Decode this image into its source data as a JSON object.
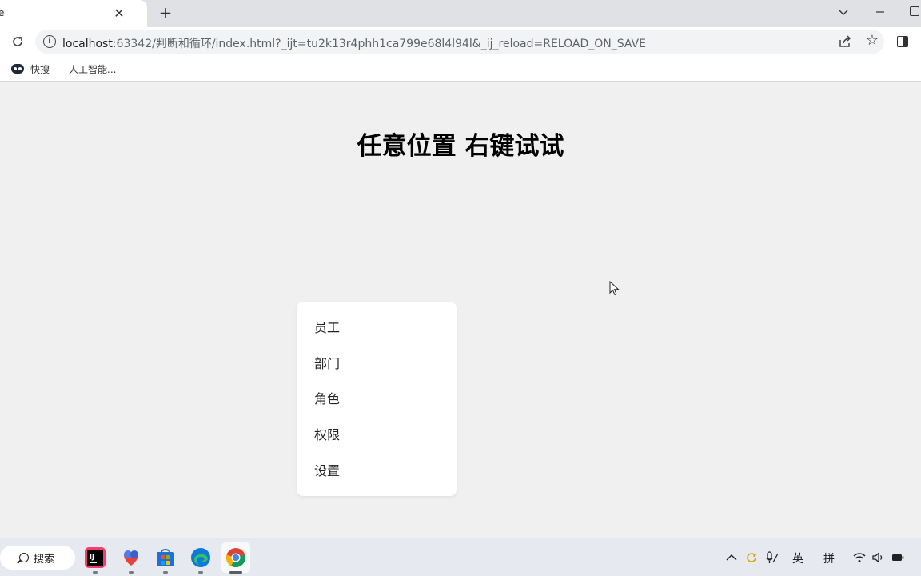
{
  "browser": {
    "tab_title": "e",
    "tab_close": "✕",
    "new_tab": "+",
    "url_host": "localhost",
    "url_rest": ":63342/判断和循环/index.html?_ijt=tu2k13r4phh1ca799e68l4l94l&_ij_reload=RELOAD_ON_SAVE",
    "info_glyph": "i",
    "star_glyph": "☆"
  },
  "bookmarks": {
    "items": [
      {
        "label": "快搜——人工智能..."
      }
    ]
  },
  "page": {
    "heading": "任意位置 右键试试"
  },
  "context_menu": {
    "items": [
      {
        "label": "员工"
      },
      {
        "label": "部门"
      },
      {
        "label": "角色"
      },
      {
        "label": "权限"
      },
      {
        "label": "设置"
      }
    ]
  },
  "taskbar": {
    "search_label": "搜索",
    "ime_lang": "英",
    "ime_mode": "拼",
    "apps": [
      "intellij-idea",
      "app-heart",
      "microsoft-store",
      "edge",
      "chrome"
    ]
  },
  "colors": {
    "page_bg": "#f0f0f0",
    "menu_bg": "#ffffff",
    "tabstrip_bg": "#dfe1e5"
  }
}
